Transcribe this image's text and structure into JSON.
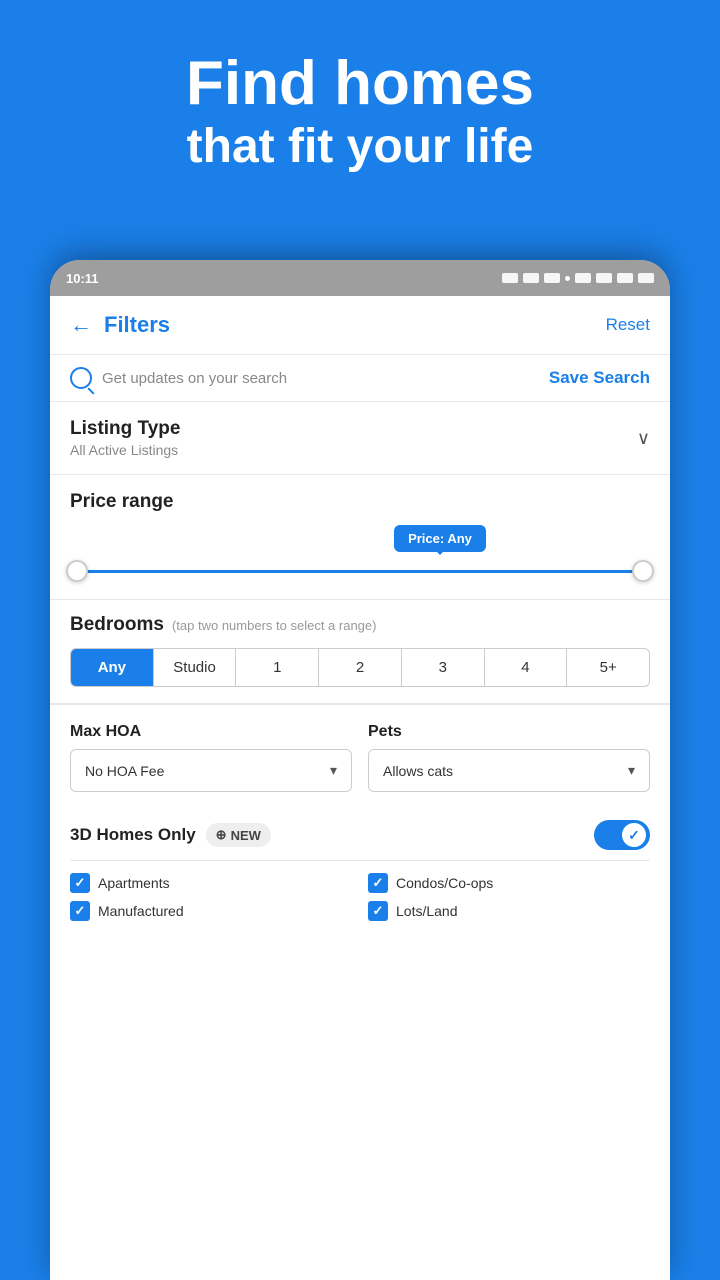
{
  "hero": {
    "title": "Find homes",
    "subtitle": "that fit your life"
  },
  "status_bar": {
    "time": "10:11",
    "icons": [
      "image",
      "linkedin",
      "youtube",
      "dot",
      "mute",
      "wifi",
      "signal",
      "battery"
    ]
  },
  "header": {
    "title": "Filters",
    "back_label": "←",
    "reset_label": "Reset"
  },
  "save_search": {
    "hint": "Get updates on your search",
    "button_label": "Save Search"
  },
  "listing_type": {
    "title": "Listing Type",
    "value": "All Active Listings"
  },
  "price_range": {
    "title": "Price range",
    "bubble_label": "Price: Any"
  },
  "bedrooms": {
    "title": "Bedrooms",
    "hint": "(tap two numbers to select a range)",
    "options": [
      "Any",
      "Studio",
      "1",
      "2",
      "3",
      "4",
      "5+"
    ],
    "active": "Any"
  },
  "max_hoa": {
    "label": "Max HOA",
    "value": "No HOA Fee"
  },
  "pets": {
    "label": "Pets",
    "value": "Allows cats"
  },
  "homes_3d": {
    "label": "3D Homes Only",
    "badge": "NEW",
    "enabled": true
  },
  "property_types": [
    {
      "label": "Apartments",
      "checked": true
    },
    {
      "label": "Condos/Co-ops",
      "checked": true
    },
    {
      "label": "Manufactured",
      "checked": true
    },
    {
      "label": "Lots/Land",
      "checked": true
    }
  ]
}
